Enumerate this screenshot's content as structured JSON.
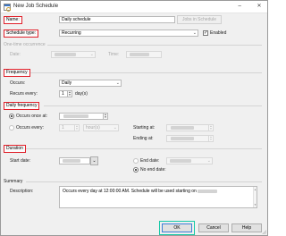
{
  "window": {
    "title": "New Job Schedule"
  },
  "name": {
    "label": "Name:",
    "value": "Daily schedule",
    "jobs_button": "Jobs in Schedule"
  },
  "schedule_type": {
    "label": "Schedule type:",
    "value": "Recurring",
    "enabled_label": "Enabled",
    "enabled": true
  },
  "one_time": {
    "section": "One-time occurrence",
    "date_label": "Date:",
    "time_label": "Time:"
  },
  "frequency": {
    "section": "Frequency",
    "occurs_label": "Occurs:",
    "occurs_value": "Daily",
    "recurs_label": "Recurs every:",
    "recurs_value": "1",
    "recurs_unit": "day(s)"
  },
  "daily_frequency": {
    "section": "Daily frequency",
    "once_label": "Occurs once at:",
    "every_label": "Occurs every:",
    "every_value": "1",
    "every_unit": "hour(s)",
    "starting_label": "Starting at:",
    "ending_label": "Ending at:",
    "selected": "once"
  },
  "duration": {
    "section": "Duration",
    "start_label": "Start date:",
    "end_date_label": "End date:",
    "no_end_label": "No end date:",
    "selected": "no_end"
  },
  "summary": {
    "section": "Summary",
    "description_label": "Description:",
    "description_text": "Occurs every day at 12:00:00 AM. Schedule will be used starting on"
  },
  "buttons": {
    "ok": "OK",
    "cancel": "Cancel",
    "help": "Help"
  },
  "icons": {
    "app": "calendar-icon",
    "minimize": "minimize-icon",
    "close": "close-icon",
    "dropdown": "chevron-down-icon"
  },
  "colors": {
    "highlight": "#e0202a",
    "ok_highlight": "#15c9a6"
  }
}
